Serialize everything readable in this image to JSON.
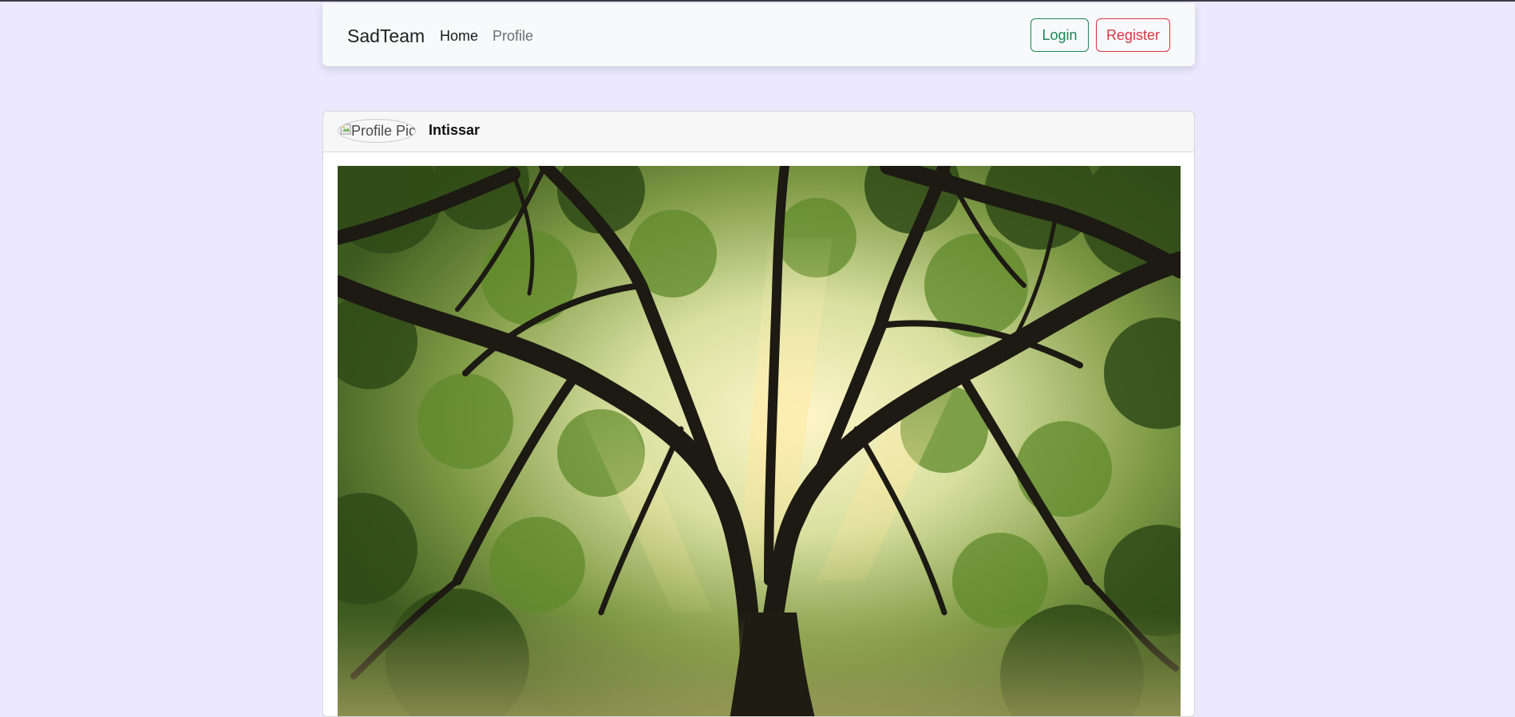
{
  "navbar": {
    "brand": "SadTeam",
    "links": [
      {
        "label": "Home",
        "active": true
      },
      {
        "label": "Profile",
        "active": false
      }
    ],
    "login_label": "Login",
    "register_label": "Register"
  },
  "post": {
    "avatar_alt": "Profile Pic",
    "username": "Intissar",
    "image_subject": "large oak tree canopy with sunbeams"
  },
  "colors": {
    "background": "#ece8fd",
    "login": "#198754",
    "register": "#dc3545"
  }
}
